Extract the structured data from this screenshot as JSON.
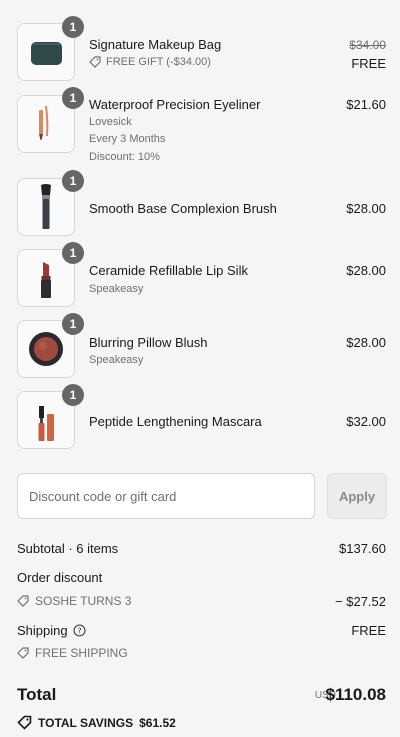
{
  "items": [
    {
      "name": "Signature Makeup Bag",
      "quantity": "1",
      "original_price": "$34.00",
      "price": "FREE",
      "tag": "FREE GIFT (-$34.00)",
      "thumb_icon": "makeup-bag-icon"
    },
    {
      "name": "Waterproof Precision Eyeliner",
      "quantity": "1",
      "price": "$21.60",
      "variant": "Lovesick",
      "frequency": "Every 3 Months",
      "discount": "Discount: 10%",
      "thumb_icon": "eyeliner-icon"
    },
    {
      "name": "Smooth Base Complexion Brush",
      "quantity": "1",
      "price": "$28.00",
      "thumb_icon": "brush-icon"
    },
    {
      "name": "Ceramide Refillable Lip Silk",
      "quantity": "1",
      "price": "$28.00",
      "variant": "Speakeasy",
      "thumb_icon": "lipstick-icon"
    },
    {
      "name": "Blurring Pillow Blush",
      "quantity": "1",
      "price": "$28.00",
      "variant": "Speakeasy",
      "thumb_icon": "blush-compact-icon"
    },
    {
      "name": "Peptide Lengthening Mascara",
      "quantity": "1",
      "price": "$32.00",
      "thumb_icon": "mascara-icon"
    }
  ],
  "discount": {
    "placeholder": "Discount code or gift card",
    "apply_label": "Apply"
  },
  "summary": {
    "subtotal_label": "Subtotal · 6 items",
    "subtotal_value": "$137.60",
    "order_discount_label": "Order discount",
    "order_discount_code": "SOSHE TURNS 3",
    "order_discount_value": "− $27.52",
    "shipping_label": "Shipping",
    "shipping_value": "FREE",
    "shipping_code": "FREE SHIPPING",
    "total_label": "Total",
    "currency": "USD",
    "total_value": "$110.08",
    "savings_label": "TOTAL SAVINGS",
    "savings_value": "$61.52"
  },
  "colors": {
    "background": "#f5f5f5",
    "badge": "#666666",
    "muted_text": "#707070"
  }
}
